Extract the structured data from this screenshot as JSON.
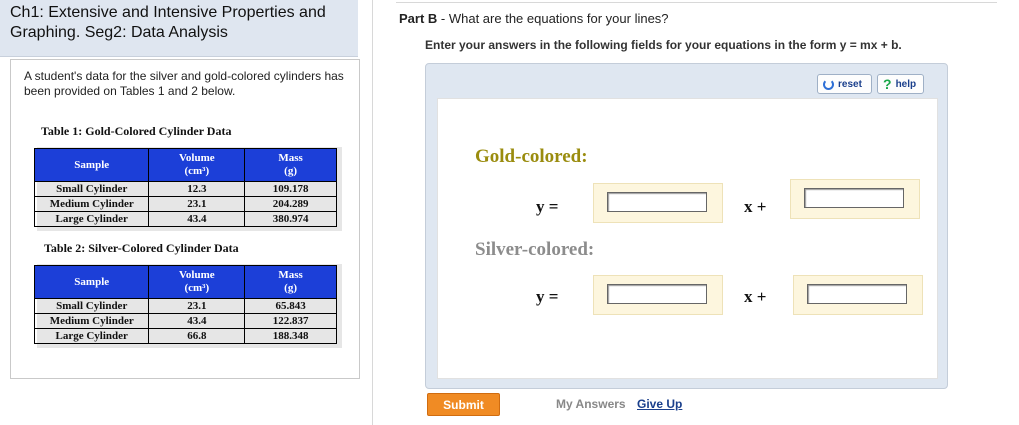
{
  "left": {
    "title": "Ch1: Extensive and Intensive Properties and Graphing. Seg2: Data Analysis",
    "intro": "A student's data for the silver and gold-colored cylinders has been provided on Tables 1 and 2 below.",
    "table1": {
      "caption": "Table 1: Gold-Colored Cylinder Data",
      "headers": [
        "Sample",
        "Volume",
        "(cm³)",
        "Mass",
        "(g)"
      ],
      "rows": [
        [
          "Small Cylinder",
          "12.3",
          "109.178"
        ],
        [
          "Medium Cylinder",
          "23.1",
          "204.289"
        ],
        [
          "Large Cylinder",
          "43.4",
          "380.974"
        ]
      ]
    },
    "table2": {
      "caption": "Table 2: Silver-Colored Cylinder Data",
      "headers": [
        "Sample",
        "Volume",
        "(cm³)",
        "Mass",
        "(g)"
      ],
      "rows": [
        [
          "Small Cylinder",
          "23.1",
          "65.843"
        ],
        [
          "Medium Cylinder",
          "43.4",
          "122.837"
        ],
        [
          "Large Cylinder",
          "66.8",
          "188.348"
        ]
      ]
    }
  },
  "right": {
    "part_label": "Part B",
    "question": " - What are the equations for your lines?",
    "instruction": "Enter your answers in the following fields for your equations in the form y = mx + b.",
    "toolbar": {
      "reset": "reset",
      "help": "help",
      "help_glyph": "?"
    },
    "gold": {
      "heading": "Gold-colored:",
      "heading_color": "#9a8c0e",
      "y_label": "y =",
      "x_label": "x +",
      "slope_value": "",
      "intercept_value": ""
    },
    "silver": {
      "heading": "Silver-colored:",
      "heading_color": "#8c8c8c",
      "y_label": "y =",
      "x_label": "x +",
      "slope_value": "",
      "intercept_value": ""
    },
    "actions": {
      "submit": "Submit",
      "my_answers": "My Answers",
      "give_up": "Give Up"
    }
  }
}
